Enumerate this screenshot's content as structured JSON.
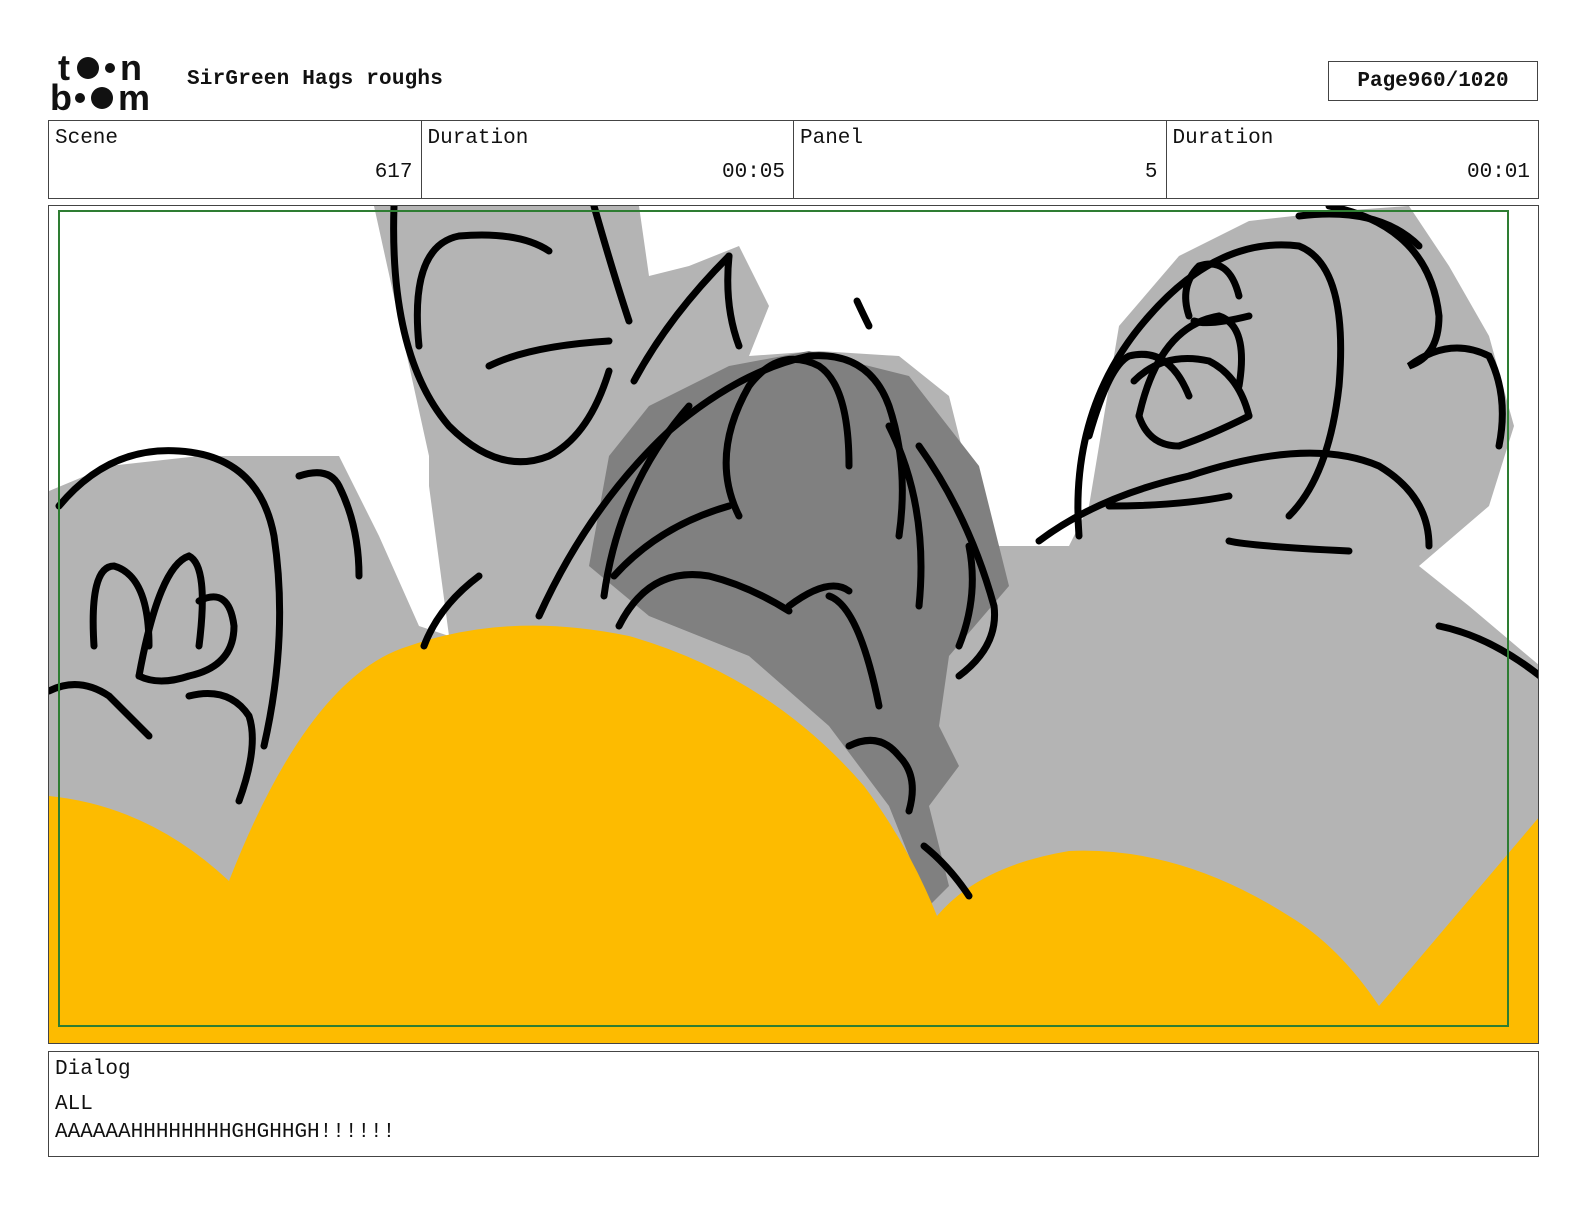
{
  "header": {
    "logo_text": "toon boom",
    "title": "SirGreen Hags roughs",
    "page_label": "Page",
    "page_number": "960/1020"
  },
  "info": {
    "scene_label": "Scene",
    "scene_value": "617",
    "scene_duration_label": "Duration",
    "scene_duration_value": "00:05",
    "panel_label": "Panel",
    "panel_value": "5",
    "panel_duration_label": "Duration",
    "panel_duration_value": "00:01"
  },
  "panel": {
    "description": "",
    "colors": {
      "yellow": "#FDBB00",
      "light_gray": "#B4B4B4",
      "dark_gray": "#808080",
      "safe_frame": "#2E7D32",
      "ink": "#000000"
    }
  },
  "dialog": {
    "label": "Dialog",
    "speaker": "ALL",
    "line": "AAAAAAHHHHHHHHGHGHHGH!!!!!!"
  }
}
